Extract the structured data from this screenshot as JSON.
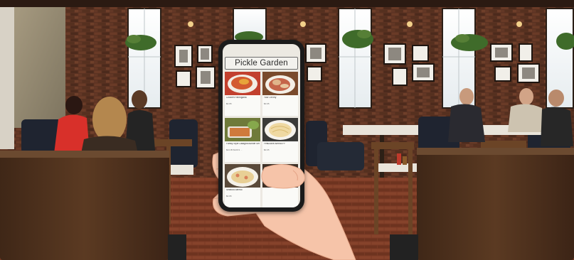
{
  "app": {
    "title": "Pickle Garden"
  },
  "menu_items": [
    {
      "name": "Chicken Parmigiana",
      "price": "$0.95"
    },
    {
      "name": "Your Off tiny",
      "price": "$0.95"
    },
    {
      "name": "Family Style Lasagna Bundle Serves 4-6",
      "price": "$44.95  $129.9 ..."
    },
    {
      "name": "Fettuccine Alfredo FF",
      "price": "$0.95"
    },
    {
      "name": "Seafood Alfredo",
      "price": "$0.95"
    },
    {
      "name": "",
      "price": ""
    }
  ],
  "colors": {
    "brick": "#5a3222",
    "booth_wood": "#4e3220",
    "floor": "#7a3a25",
    "hand_skin": "#f6c4a9",
    "phone_body": "#1b1b1b"
  }
}
